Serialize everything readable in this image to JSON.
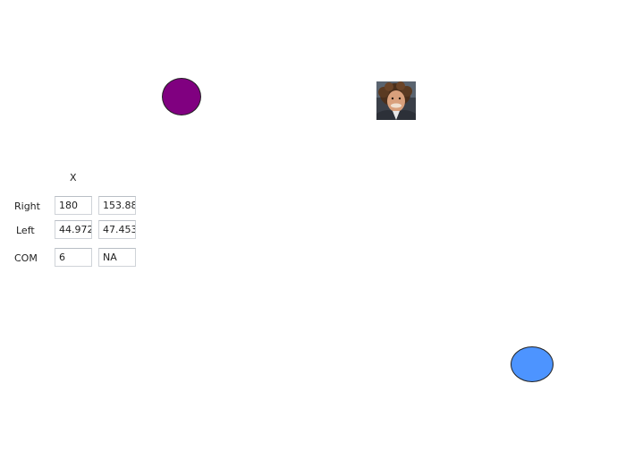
{
  "header": {
    "x_label": "X"
  },
  "rows": {
    "right": {
      "label": "Right",
      "value1": "180",
      "value2": "153.88"
    },
    "left": {
      "label": "Left",
      "value1": "44.972",
      "value2": "47.453"
    },
    "com": {
      "label": "COM",
      "value1": "6",
      "value2": "NA"
    }
  },
  "colors": {
    "purple_circle": "#800080",
    "blue_circle": "#4d94ff"
  },
  "icons": {
    "photo": "person-photo"
  }
}
